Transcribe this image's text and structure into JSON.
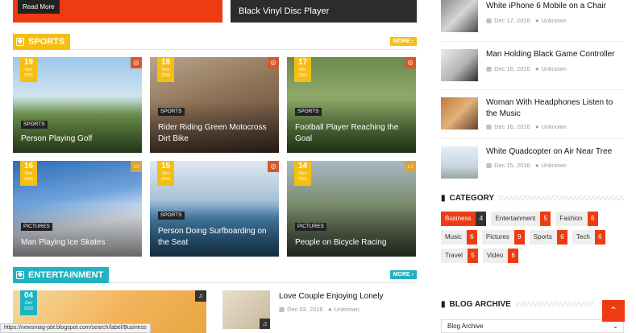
{
  "top": {
    "read_more_label": "Read More",
    "right_title": "Black Vinyl Disc Player"
  },
  "sports": {
    "title": "SPORTS",
    "more_label": "MORE ›",
    "color": "#f5be13",
    "tiles": [
      {
        "day": "19",
        "month": "Nov",
        "year": "2016",
        "category": "SPORTS",
        "title": "Person Playing Golf",
        "icon": "camera-icon"
      },
      {
        "day": "18",
        "month": "Nov",
        "year": "2016",
        "category": "SPORTS",
        "title": "Rider Riding Green Motocross Dirt Bike",
        "icon": "camera-icon"
      },
      {
        "day": "17",
        "month": "Nov",
        "year": "2016",
        "category": "SPORTS",
        "title": "Football Player Reaching the Goal",
        "icon": "camera-icon"
      },
      {
        "day": "16",
        "month": "Nov",
        "year": "2016",
        "category": "PICTURES",
        "title": "Man Playing Ice Skates",
        "icon": "image-icon"
      },
      {
        "day": "15",
        "month": "Nov",
        "year": "2016",
        "category": "SPORTS",
        "title": "Person Doing Surfboarding on the Seat",
        "icon": "camera-icon"
      },
      {
        "day": "14",
        "month": "Nov",
        "year": "2016",
        "category": "PICTURES",
        "title": "People on Bicycle Racing",
        "icon": "image-icon"
      }
    ]
  },
  "entertainment": {
    "title": "ENTERTAINMENT",
    "more_label": "MORE ›",
    "color": "#1fb3c1",
    "big": {
      "day": "04",
      "month": "Dec",
      "year": "2016"
    },
    "post": {
      "title": "Love Couple Enjoying Lonely",
      "date": "Dec 03, 2016",
      "author": "Unknown"
    }
  },
  "sidebar": {
    "posts": [
      {
        "title": "White iPhone 6 Mobile on a Chair",
        "date": "Dec 17, 2016",
        "author": "Unknown"
      },
      {
        "title": "Man Holding Black Game Controller",
        "date": "Dec 16, 2016",
        "author": "Unknown"
      },
      {
        "title": "Woman With Headphones Listen to the Music",
        "date": "Dec 16, 2016",
        "author": "Unknown"
      },
      {
        "title": "White Quadcopter on Air Near Tree",
        "date": "Dec 15, 2016",
        "author": "Unknown"
      }
    ],
    "category_title": "CATEGORY",
    "categories": [
      {
        "name": "Business",
        "count": "4",
        "active": true
      },
      {
        "name": "Entertainment",
        "count": "5"
      },
      {
        "name": "Fashion",
        "count": "6"
      },
      {
        "name": "Music",
        "count": "6"
      },
      {
        "name": "Pictures",
        "count": "9"
      },
      {
        "name": "Sports",
        "count": "6"
      },
      {
        "name": "Tech",
        "count": "6"
      },
      {
        "name": "Travel",
        "count": "5"
      },
      {
        "name": "Video",
        "count": "6"
      }
    ],
    "archive_title": "BLOG ARCHIVE",
    "archive_select": "Blog Archive"
  },
  "status_url": "https://newsmag-pbt.blogspot.com/search/label/Business",
  "accent": "#ef3b12"
}
